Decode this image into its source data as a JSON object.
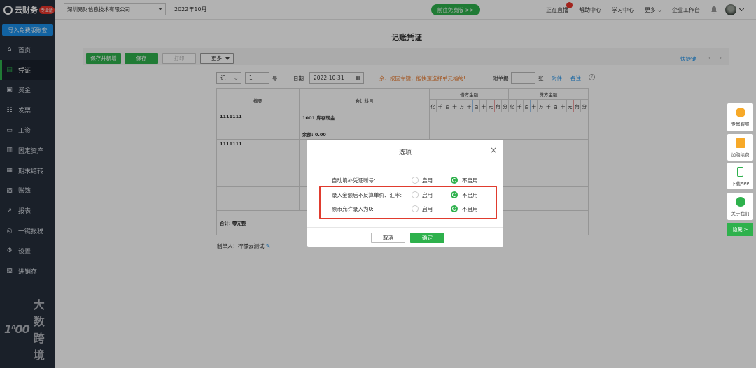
{
  "brand": {
    "name": "云财务",
    "edition_badge": "专业版"
  },
  "sidebar": {
    "import_label": "导入免费版账套",
    "items": [
      {
        "label": "首页",
        "icon": "home-icon"
      },
      {
        "label": "凭证",
        "icon": "voucher-icon",
        "active": true
      },
      {
        "label": "资金",
        "icon": "funds-icon"
      },
      {
        "label": "发票",
        "icon": "invoice-icon"
      },
      {
        "label": "工资",
        "icon": "salary-icon"
      },
      {
        "label": "固定资产",
        "icon": "fixed-assets-icon"
      },
      {
        "label": "期末结转",
        "icon": "period-end-icon"
      },
      {
        "label": "账簿",
        "icon": "ledger-icon"
      },
      {
        "label": "报表",
        "icon": "report-icon"
      },
      {
        "label": "一键报税",
        "icon": "tax-icon"
      },
      {
        "label": "设置",
        "icon": "gear-icon"
      },
      {
        "label": "进销存",
        "icon": "inventory-icon"
      }
    ],
    "watermark": {
      "mark": "1ᐢ00",
      "text": "大数跨境"
    }
  },
  "topbar": {
    "company": "深圳易财信息技术有限公司",
    "period": "2022年10月",
    "free_version_btn": "前往免费版 >>",
    "links": [
      "正在直播",
      "帮助中心",
      "学习中心",
      "更多",
      "企业工作台"
    ]
  },
  "page": {
    "title": "记账凭证"
  },
  "toolbar": {
    "save_new": "保存并新增",
    "save": "保存",
    "print": "打印",
    "more": "更多",
    "shortcut": "快捷键"
  },
  "voucher": {
    "word": "记",
    "number": "1",
    "number_label": "号",
    "date_label": "日期:",
    "date": "2022-10-31",
    "hint": "余、按回车键，能快速选择单元格的!",
    "attach_label": "附单据",
    "attach_unit": "张",
    "attach_link": "附件",
    "remark_link": "备注",
    "help": "?",
    "col_summary": "摘要",
    "col_account": "会计科目",
    "col_debit": "借方金额",
    "col_credit": "贷方金额",
    "digits": [
      "亿",
      "千",
      "百",
      "十",
      "万",
      "千",
      "百",
      "十",
      "元",
      "角",
      "分"
    ],
    "rows": [
      {
        "summary": "1111111",
        "account": "1001 库存现金",
        "balance": "余额: 0.00"
      },
      {
        "summary": "1111111",
        "account": "",
        "balance": ""
      }
    ],
    "total_label": "合计: 零元整",
    "preparer": "制单人：柠檬云测试"
  },
  "float_panel": {
    "service": "专属客服",
    "buy": "加购续费",
    "app": "下载APP",
    "follow": "关于我们",
    "hide": "隐藏 >"
  },
  "dialog": {
    "title": "选项",
    "options": [
      {
        "label": "自动填补凭证断号:",
        "enable": "启用",
        "disable": "不启用",
        "selected": "disable"
      },
      {
        "label": "录入金额后不反算单价、汇率:",
        "enable": "启用",
        "disable": "不启用",
        "selected": "disable"
      },
      {
        "label": "原币允许录入为0:",
        "enable": "启用",
        "disable": "不启用",
        "selected": "disable"
      }
    ],
    "cancel": "取消",
    "ok": "确定"
  },
  "colors": {
    "accent": "#2eb14c",
    "sidebar": "#262e3b",
    "link": "#1a8fe8",
    "highlight": "#e03b2e"
  }
}
